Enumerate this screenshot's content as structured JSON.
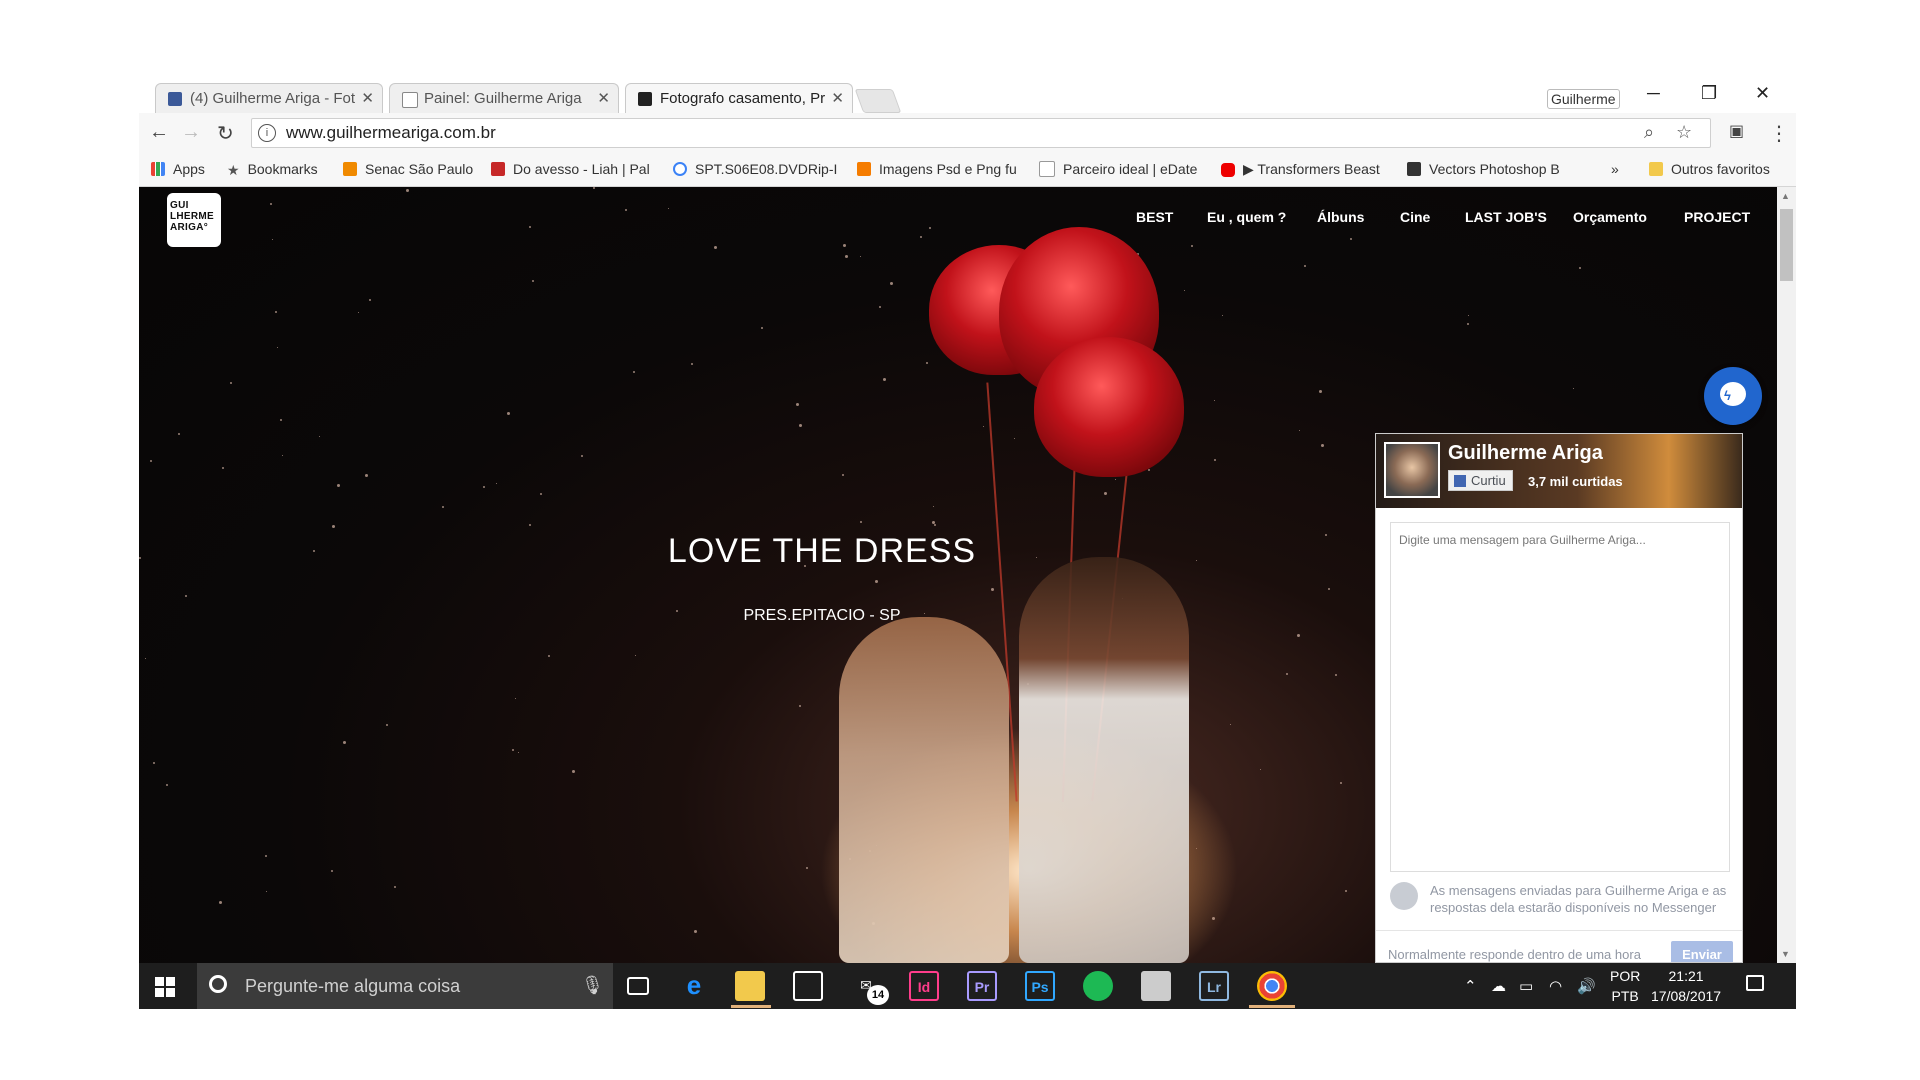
{
  "browser": {
    "tabs": [
      {
        "label": "(4) Guilherme Ariga - Fot",
        "close": "✕",
        "icon": "facebook-icon"
      },
      {
        "label": "Painel: Guilherme Ariga",
        "close": "✕",
        "icon": "page-icon"
      },
      {
        "label": "Fotografo casamento, Pr",
        "close": "✕",
        "icon": "site-icon"
      }
    ],
    "profile": "Guilherme",
    "window_controls": {
      "minimize": "─",
      "restore": "❐",
      "close": "✕"
    },
    "url": "www.guilhermeariga.com.br",
    "info_glyph": "i",
    "nav": {
      "back": "←",
      "forward": "→",
      "reload": "↻"
    },
    "bookmarks": [
      {
        "label": "Apps"
      },
      {
        "label": "Bookmarks"
      },
      {
        "label": "Senac São Paulo"
      },
      {
        "label": "Do avesso - Liah | Pal"
      },
      {
        "label": "SPT.S06E08.DVDRip-I"
      },
      {
        "label": "Imagens Psd e Png fu"
      },
      {
        "label": "Parceiro ideal | eDate"
      },
      {
        "label": "▶ Transformers Beast"
      },
      {
        "label": "Vectors Photoshop B"
      }
    ],
    "bookmarks_more": "»",
    "other_bookmarks": "Outros favoritos"
  },
  "site": {
    "logo_lines": [
      "GUI",
      "LHERME",
      "ARIGA°"
    ],
    "nav": [
      "BEST",
      "Eu , quem ?",
      "Álbuns",
      "Cine",
      "LAST JOB'S",
      "Orçamento",
      "PROJECT"
    ],
    "hero_title": "LOVE THE DRESS",
    "hero_subtitle": "PRES.EPITACIO - SP"
  },
  "messenger": {
    "page_name": "Guilherme Ariga",
    "like_label": "Curtiu",
    "likes": "3,7 mil curtidas",
    "placeholder": "Digite uma mensagem para Guilherme Ariga...",
    "note": "As mensagens enviadas para Guilherme Ariga e as respostas dela estarão disponíveis no Messenger",
    "response_time": "Normalmente responde dentro de uma hora",
    "send_label": "Enviar"
  },
  "taskbar": {
    "search_placeholder": "Pergunte-me alguma coisa",
    "mail_badge": "14",
    "lang_line1": "POR",
    "lang_line2": "PTB",
    "time": "21:21",
    "date": "17/08/2017"
  },
  "colors": {
    "messenger_blue": "#2166ce",
    "facebook_blue": "#4267b2",
    "taskbar_bg": "#1e1e1e"
  }
}
